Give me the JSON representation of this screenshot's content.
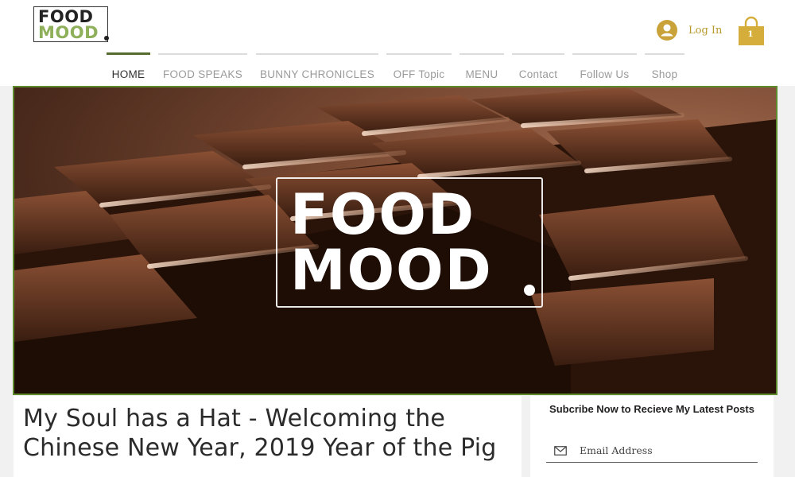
{
  "brand": {
    "logo_line1": "FOOD",
    "logo_line2": "MOOD",
    "logo_accent": "#8fb05a"
  },
  "header": {
    "login_label": "Log In",
    "cart_count": "1",
    "accent_color": "#b79a2c"
  },
  "nav": {
    "items": [
      {
        "label": "HOME",
        "active": true
      },
      {
        "label": "FOOD SPEAKS"
      },
      {
        "label": "BUNNY CHRONICLES"
      },
      {
        "label": "OFF Topic"
      },
      {
        "label": "MENU"
      },
      {
        "label": "Contact"
      },
      {
        "label": "Follow Us"
      },
      {
        "label": "Shop"
      }
    ]
  },
  "hero": {
    "logo_line1": "FOOD",
    "logo_line2": "MOOD",
    "frame_color": "#5f8b2f"
  },
  "post": {
    "title": "My Soul has a Hat - Welcoming the Chinese New Year, 2019 Year of the Pig"
  },
  "subscribe": {
    "title": "Subcribe Now to Recieve My Latest Posts",
    "email_placeholder": "Email Address"
  },
  "icons": {
    "login": "avatar-icon",
    "cart": "shopping-bag-icon",
    "email": "mail-icon"
  }
}
